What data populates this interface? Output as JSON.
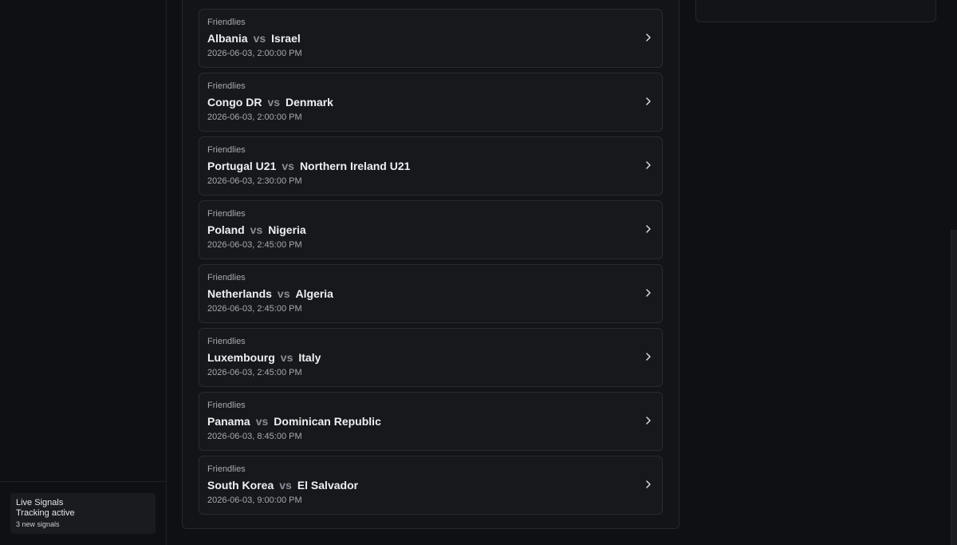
{
  "sidebar": {
    "live_widget": {
      "title": "Live Signals",
      "status": "Tracking active",
      "count": "3 new signals"
    }
  },
  "matches": {
    "vs_label": "vs",
    "items": [
      {
        "league": "Friendlies",
        "home": "Albania",
        "away": "Israel",
        "time": "2026-06-03, 2:00:00 PM"
      },
      {
        "league": "Friendlies",
        "home": "Congo DR",
        "away": "Denmark",
        "time": "2026-06-03, 2:00:00 PM"
      },
      {
        "league": "Friendlies",
        "home": "Portugal U21",
        "away": "Northern Ireland U21",
        "time": "2026-06-03, 2:30:00 PM"
      },
      {
        "league": "Friendlies",
        "home": "Poland",
        "away": "Nigeria",
        "time": "2026-06-03, 2:45:00 PM"
      },
      {
        "league": "Friendlies",
        "home": "Netherlands",
        "away": "Algeria",
        "time": "2026-06-03, 2:45:00 PM"
      },
      {
        "league": "Friendlies",
        "home": "Luxembourg",
        "away": "Italy",
        "time": "2026-06-03, 2:45:00 PM"
      },
      {
        "league": "Friendlies",
        "home": "Panama",
        "away": "Dominican Republic",
        "time": "2026-06-03, 8:45:00 PM"
      },
      {
        "league": "Friendlies",
        "home": "South Korea",
        "away": "El Salvador",
        "time": "2026-06-03, 9:00:00 PM"
      }
    ]
  },
  "icons": {
    "row_action": "chevron-right-icon"
  }
}
